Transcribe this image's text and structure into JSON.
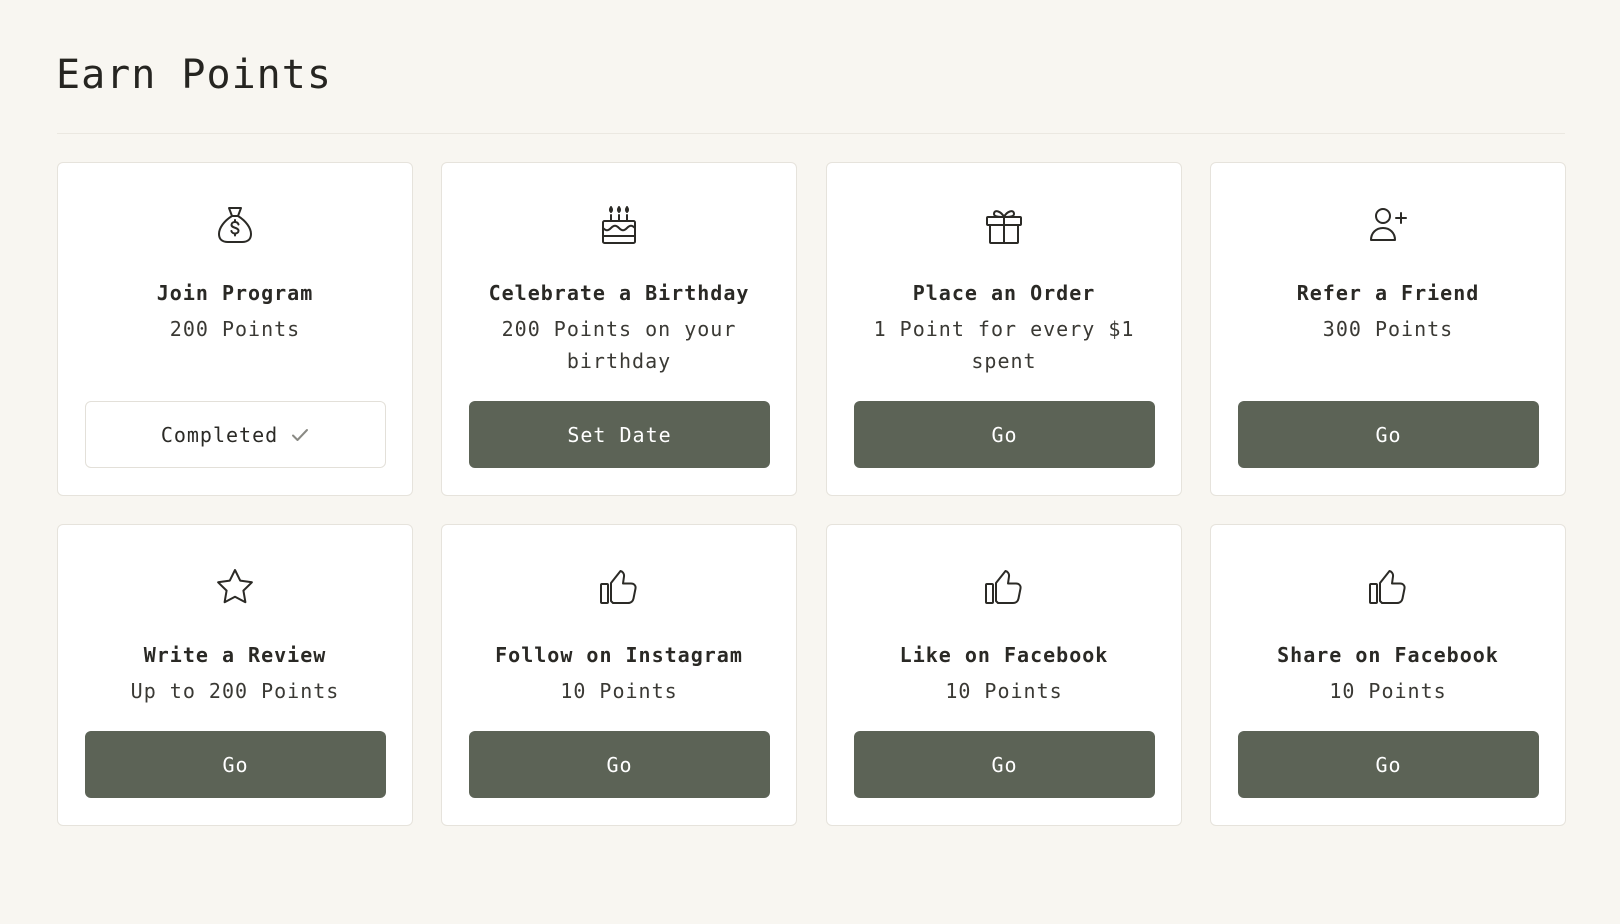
{
  "page": {
    "title": "Earn Points"
  },
  "cards": [
    {
      "title": "Join Program",
      "desc": "200 Points",
      "button": "Completed",
      "icon": "money-bag-icon"
    },
    {
      "title": "Celebrate a Birthday",
      "desc": "200 Points on your birthday",
      "button": "Set Date",
      "icon": "birthday-cake-icon"
    },
    {
      "title": "Place an Order",
      "desc": "1 Point for every $1 spent",
      "button": "Go",
      "icon": "gift-icon"
    },
    {
      "title": "Refer a Friend",
      "desc": "300 Points",
      "button": "Go",
      "icon": "add-user-icon"
    },
    {
      "title": "Write a Review",
      "desc": "Up to 200 Points",
      "button": "Go",
      "icon": "star-icon"
    },
    {
      "title": "Follow on Instagram",
      "desc": "10 Points",
      "button": "Go",
      "icon": "thumbs-up-icon"
    },
    {
      "title": "Like on Facebook",
      "desc": "10 Points",
      "button": "Go",
      "icon": "thumbs-up-icon"
    },
    {
      "title": "Share on Facebook",
      "desc": "10 Points",
      "button": "Go",
      "icon": "thumbs-up-icon"
    }
  ],
  "colors": {
    "background": "#f8f6f1",
    "button": "#5c6356",
    "card": "#ffffff",
    "text": "#2b2a26"
  }
}
